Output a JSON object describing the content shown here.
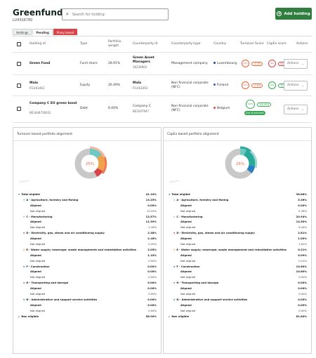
{
  "header": {
    "fund_name": "Greenfund",
    "fund_id": "LU43S6780",
    "search_placeholder": "Search for holding",
    "add_button_label": "Add holding"
  },
  "tabs": [
    {
      "label": "Holdings"
    },
    {
      "label": "Pending"
    },
    {
      "label": "Proxy based"
    }
  ],
  "table": {
    "headers": {
      "holding_id": "Holding id",
      "type": "Type",
      "portfolio_weight_1": "Portfolio",
      "portfolio_weight_2": "weight",
      "counterparty_id": "Counterparty id",
      "counterparty_type": "Counterparty type",
      "country": "Country",
      "turnover_score": "Turnover Score",
      "capex_score": "CapEx score",
      "actions": "Actions"
    },
    "rows": [
      {
        "holding_name": "Green Fund",
        "holding_id": "",
        "type": "Fund share",
        "weight": "28.91%",
        "counterparty_name_1": "Green Asset",
        "counterparty_name_2": "Managers",
        "counterparty_id": "36236662",
        "counterparty_type_1": "Management company",
        "counterparty_type_2": "",
        "country": "Luxembourg",
        "country_color": "#1f3d8a",
        "turnover_ring": "10%",
        "turnover_pill": "11.3%",
        "turnover_color": "#e8643a",
        "capex_ring": "9%",
        "capex_pill": "34.9%",
        "capex_color": "#d9444b",
        "actions_label": "Actions"
      },
      {
        "holding_name": "Mala",
        "holding_id": "FI1463463",
        "type": "Equity",
        "weight": "26.49%",
        "counterparty_name_1": "Mala",
        "counterparty_name_2": "",
        "counterparty_id": "FI1463463",
        "counterparty_type_1": "Non financial corporate",
        "counterparty_type_2": "(NFC)",
        "country": "Finland",
        "country_color": "#2a5cb8",
        "turnover_ring": "70%",
        "turnover_pill": "11.6%",
        "turnover_color": "#e8643a",
        "capex_ring": "70%",
        "capex_pill": "75.9%",
        "capex_color": "#3aa657",
        "actions_label": "Actions"
      },
      {
        "holding_name": "Company C EU green bond",
        "holding_id": "BE3448736631",
        "type": "Debt",
        "weight": "6.00%",
        "counterparty_name_1": "Company C",
        "counterparty_name_2": "",
        "counterparty_id": "BE3247947",
        "counterparty_type_1": "Non financial corporate",
        "counterparty_type_2": "(NFC)",
        "country": "Belgium",
        "country_color": "#d9444b",
        "turnover_ring": "",
        "turnover_pill": "",
        "turnover_color": "",
        "capex_ring": "100%",
        "capex_pill": "100.00%",
        "capex_color": "#3aa657",
        "capex_tag": "Use of proceeds",
        "actions_label": "Actions"
      }
    ]
  },
  "panels": [
    {
      "title": "Turnover based portfolio alignment",
      "center_value": "25%",
      "rows": [
        {
          "label": "Total eligible",
          "value": "41.10%",
          "level": 0,
          "bold": true,
          "color": "#3aa657",
          "marker": "▼"
        },
        {
          "label": "A - Agriculture, forestry and fishing",
          "value": "13.25%",
          "level": 1,
          "bold": true,
          "color": "#6ec9c0",
          "marker": "▼"
        },
        {
          "label": "Aligned",
          "value": "0.00%",
          "level": 2,
          "bold": true
        },
        {
          "label": "Not aligned",
          "value": "13.25%",
          "level": 2,
          "bold": false
        },
        {
          "label": "C - Manufacturing",
          "value": "13.57%",
          "level": 1,
          "bold": true,
          "color": "#9fb7d9",
          "marker": "▼"
        },
        {
          "label": "Aligned",
          "value": "11.39%",
          "level": 2,
          "bold": true
        },
        {
          "label": "Not aligned",
          "value": "2.18%",
          "level": 2,
          "bold": false
        },
        {
          "label": "D - Electricity, gas, steam and air conditioning supply",
          "value": "2.38%",
          "level": 1,
          "bold": true,
          "color": "#d9444b",
          "marker": "▼"
        },
        {
          "label": "Aligned",
          "value": "2.18%",
          "level": 2,
          "bold": true
        },
        {
          "label": "Not aligned",
          "value": "0.20%",
          "level": 2,
          "bold": false
        },
        {
          "label": "E - Water supply; sewerage; waste management and remediation activities",
          "value": "2.05%",
          "level": 1,
          "bold": true,
          "color": "#f0a24a",
          "marker": "▼"
        },
        {
          "label": "Aligned",
          "value": "1.15%",
          "level": 2,
          "bold": true
        },
        {
          "label": "Not aligned",
          "value": "0.90%",
          "level": 2,
          "bold": false
        },
        {
          "label": "F - Construction",
          "value": "0.00%",
          "level": 1,
          "bold": true,
          "color": "#2a7fc1",
          "marker": "▼"
        },
        {
          "label": "Aligned",
          "value": "0.00%",
          "level": 2,
          "bold": true
        },
        {
          "label": "Not aligned",
          "value": "0.00%",
          "level": 2,
          "bold": false
        },
        {
          "label": "H - Transporting and storage",
          "value": "0.00%",
          "level": 1,
          "bold": true,
          "color": "#777777",
          "marker": "▼"
        },
        {
          "label": "Aligned",
          "value": "0.00%",
          "level": 2,
          "bold": true
        },
        {
          "label": "Not aligned",
          "value": "0.00%",
          "level": 2,
          "bold": false
        },
        {
          "label": "N - Administrative and support service activities",
          "value": "0.00%",
          "level": 1,
          "bold": true,
          "color": "#3aa657",
          "marker": "▼"
        },
        {
          "label": "Aligned",
          "value": "0.00%",
          "level": 2,
          "bold": true
        },
        {
          "label": "Not aligned",
          "value": "0.00%",
          "level": 2,
          "bold": false
        },
        {
          "label": "Non eligible",
          "value": "58.90%",
          "level": 0,
          "bold": true,
          "color": "#999999",
          "marker": "▶"
        }
      ]
    },
    {
      "title": "CapEx based portfolio alignment",
      "center_value": "26%",
      "rows": [
        {
          "label": "Total eligible",
          "value": "38.86%",
          "level": 0,
          "bold": true,
          "color": "#3aa657",
          "marker": "▼"
        },
        {
          "label": "A - Agriculture, forestry and fishing",
          "value": "5.36%",
          "level": 1,
          "bold": true,
          "color": "#6ec9c0",
          "marker": "▼"
        },
        {
          "label": "Aligned",
          "value": "0.00%",
          "level": 2,
          "bold": true
        },
        {
          "label": "Not aligned",
          "value": "5.36%",
          "level": 2,
          "bold": false
        },
        {
          "label": "C - Manufacturing",
          "value": "20.94%",
          "level": 1,
          "bold": true,
          "color": "#9fb7d9",
          "marker": "▼"
        },
        {
          "label": "Aligned",
          "value": "14.50%",
          "level": 2,
          "bold": true
        },
        {
          "label": "Not aligned",
          "value": "6.44%",
          "level": 2,
          "bold": false
        },
        {
          "label": "D - Electricity, gas, steam and air conditioning supply",
          "value": "2.81%",
          "level": 1,
          "bold": true,
          "color": "#d9444b",
          "marker": "▼"
        },
        {
          "label": "Aligned",
          "value": "1.00%",
          "level": 2,
          "bold": true
        },
        {
          "label": "Not aligned",
          "value": "1.81%",
          "level": 2,
          "bold": false
        },
        {
          "label": "E - Water supply; sewerage; waste management and remediation activities",
          "value": "0.21%",
          "level": 1,
          "bold": true,
          "color": "#f0a24a",
          "marker": "▼"
        },
        {
          "label": "Aligned",
          "value": "0.09%",
          "level": 2,
          "bold": true
        },
        {
          "label": "Not aligned",
          "value": "0.12%",
          "level": 2,
          "bold": false
        },
        {
          "label": "F - Construction",
          "value": "10.60%",
          "level": 1,
          "bold": true,
          "color": "#2a7fc1",
          "marker": "▼"
        },
        {
          "label": "Aligned",
          "value": "10.60%",
          "level": 2,
          "bold": true
        },
        {
          "label": "Not aligned",
          "value": "0.00%",
          "level": 2,
          "bold": false
        },
        {
          "label": "H - Transporting and storage",
          "value": "0.00%",
          "level": 1,
          "bold": true,
          "color": "#777777",
          "marker": "▼"
        },
        {
          "label": "Aligned",
          "value": "0.00%",
          "level": 2,
          "bold": true
        },
        {
          "label": "Not aligned",
          "value": "0.00%",
          "level": 2,
          "bold": false
        },
        {
          "label": "N - Administrative and support service activities",
          "value": "0.00%",
          "level": 1,
          "bold": true,
          "color": "#3aa657",
          "marker": "▼"
        },
        {
          "label": "Aligned",
          "value": "0.00%",
          "level": 2,
          "bold": true
        },
        {
          "label": "Not aligned",
          "value": "0.00%",
          "level": 2,
          "bold": false
        },
        {
          "label": "Non eligible",
          "value": "61.64%",
          "level": 0,
          "bold": true,
          "color": "#999999",
          "marker": "▶"
        }
      ]
    }
  ],
  "colors": {
    "brand_green": "#2f7d3f",
    "alert_red": "#d9444b",
    "warn_orange": "#e8643a",
    "ok_green": "#3aa657"
  }
}
